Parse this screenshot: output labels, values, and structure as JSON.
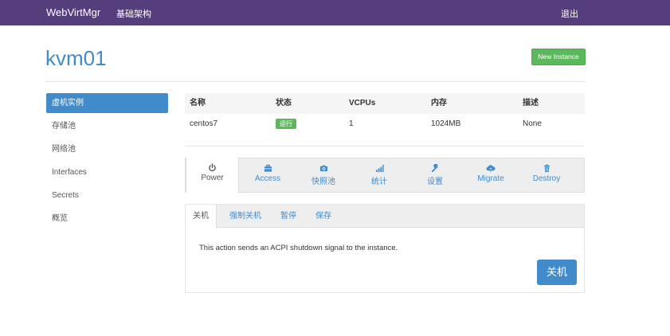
{
  "navbar": {
    "brand": "WebVirtMgr",
    "link": "基础架构",
    "logout": "退出"
  },
  "page": {
    "title": "kvm01",
    "new_instance": "New Instance"
  },
  "sidebar": {
    "items": [
      {
        "label": "虚机实例",
        "active": true
      },
      {
        "label": "存储池"
      },
      {
        "label": "网络池"
      },
      {
        "label": "Interfaces"
      },
      {
        "label": "Secrets"
      },
      {
        "label": "概览"
      }
    ]
  },
  "table": {
    "headers": [
      "名称",
      "状态",
      "VCPUs",
      "内存",
      "描述"
    ],
    "row": {
      "name": "centos7",
      "status": "运行",
      "vcpus": "1",
      "memory": "1024MB",
      "description": "None"
    }
  },
  "tabs": [
    {
      "label": "Power",
      "icon": "power-icon",
      "active": true
    },
    {
      "label": "Access",
      "icon": "briefcase-icon"
    },
    {
      "label": "快照池",
      "icon": "camera-icon"
    },
    {
      "label": "统计",
      "icon": "signal-icon"
    },
    {
      "label": "设置",
      "icon": "wrench-icon"
    },
    {
      "label": "Migrate",
      "icon": "cloud-upload-icon"
    },
    {
      "label": "Destroy",
      "icon": "trash-icon"
    }
  ],
  "power": {
    "subtabs": [
      "关机",
      "强制关机",
      "暂停",
      "保存"
    ],
    "message": "This action sends an ACPI shutdown signal to the instance.",
    "button": "关机"
  },
  "colors": {
    "navbar": "#563d7c",
    "accent": "#428bca",
    "success": "#5cb85c"
  }
}
